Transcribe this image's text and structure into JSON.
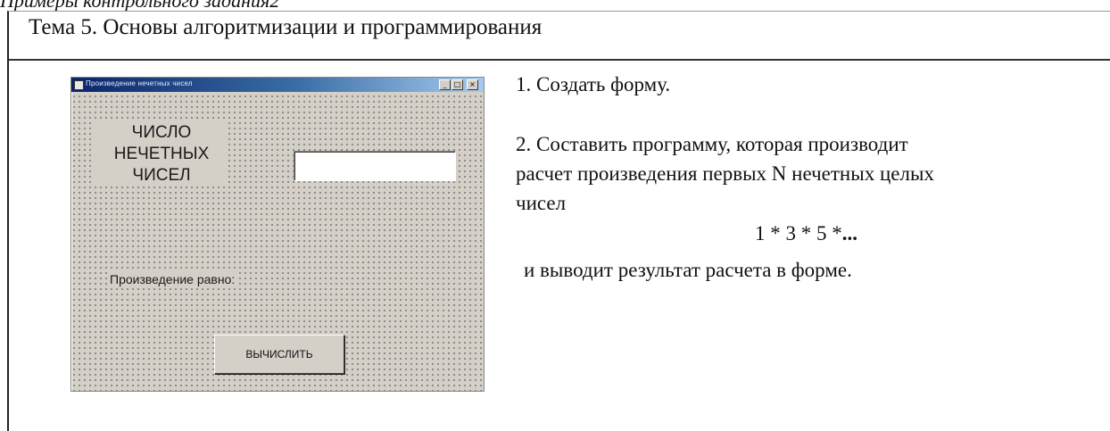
{
  "caption": "Примеры контрольного задания2",
  "topic": {
    "title": "Тема 5. Основы алгоритмизации и программирования"
  },
  "form": {
    "window_title": "Произведение нечетных чисел",
    "minimize": "_",
    "maximize": "□",
    "close": "×",
    "count_label": "ЧИСЛО НЕЧЕТНЫХ ЧИСЕЛ",
    "count_input_value": "",
    "result_label": "Произведение  равно:",
    "calculate_button": "ВЫЧИСЛИТЬ",
    "colors": {
      "face": "#d4d0c8",
      "title_start": "#0a246a",
      "title_end": "#a6caf0"
    }
  },
  "tasks": {
    "step1": "1. Создать форму.",
    "step2_line1": "2. Составить программу, которая производит",
    "step2_line2": "расчет произведения первых N нечетных целых",
    "step2_line3": "чисел",
    "formula": "1 * 3 * 5 *",
    "formula_dots": "...",
    "step3": "и выводит результат расчета в форме."
  }
}
